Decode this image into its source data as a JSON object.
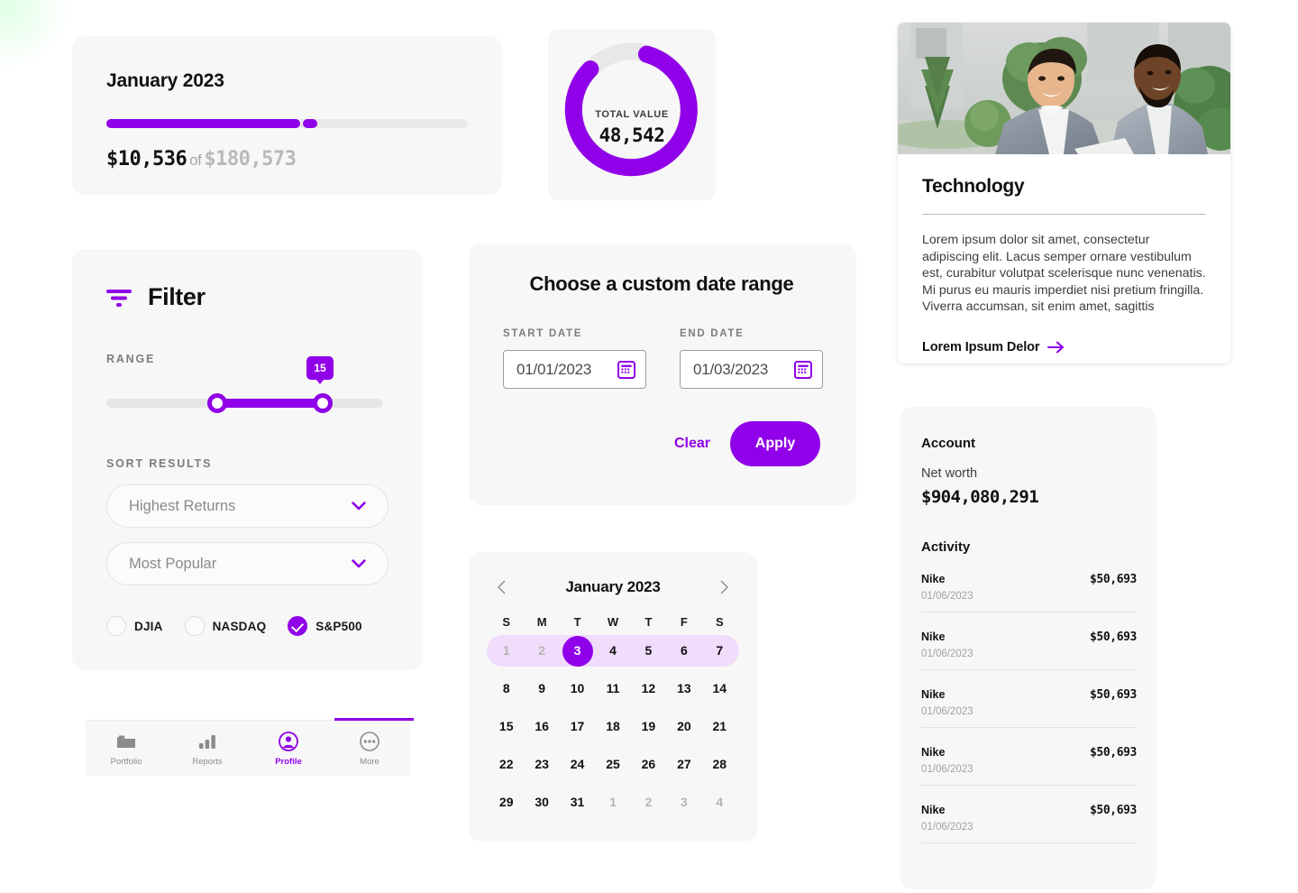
{
  "theme": {
    "accent": "#9000e8",
    "card_bg": "#f7f7f7",
    "page_bg": "#ffffff",
    "highlight": "#f0dcfb"
  },
  "progress_card": {
    "title": "January 2023",
    "current_amount": "$10,536",
    "of_word": "of",
    "total_amount": "$180,573",
    "percent_filled": 54
  },
  "donut_card": {
    "label": "TOTAL VALUE",
    "value": "48,542",
    "percent_filled": 76
  },
  "filter_panel": {
    "icon": "filter-funnel-icon",
    "title": "Filter",
    "range_label": "RANGE",
    "range_value": "15",
    "range_low_pct": 40,
    "range_high_pct": 78,
    "sort_label": "SORT RESULTS",
    "selects": [
      {
        "value": "Highest Returns",
        "icon": "chevron-down-icon"
      },
      {
        "value": "Most Popular",
        "icon": "chevron-down-icon"
      }
    ],
    "radios": [
      {
        "label": "DJIA",
        "checked": false
      },
      {
        "label": "NASDAQ",
        "checked": false
      },
      {
        "label": "S&P500",
        "checked": true
      }
    ]
  },
  "bottom_nav": {
    "items": [
      {
        "label": "Portfolio",
        "icon": "folder-icon",
        "active": false
      },
      {
        "label": "Reports",
        "icon": "bar-chart-icon",
        "active": false
      },
      {
        "label": "Profile",
        "icon": "user-circle-icon",
        "active": true
      },
      {
        "label": "More",
        "icon": "ellipsis-circle-icon",
        "active": false
      }
    ]
  },
  "date_range_card": {
    "title": "Choose a custom date range",
    "start": {
      "label": "START DATE",
      "value": "01/01/2023",
      "icon": "calendar-icon"
    },
    "end": {
      "label": "END DATE",
      "value": "01/03/2023",
      "icon": "calendar-icon"
    },
    "clear_label": "Clear",
    "apply_label": "Apply"
  },
  "calendar_card": {
    "month": "January 2023",
    "prev_icon": "chevron-left-icon",
    "next_icon": "chevron-right-icon",
    "weekdays": [
      "S",
      "M",
      "T",
      "W",
      "T",
      "F",
      "S"
    ],
    "weeks": [
      {
        "highlight": true,
        "days": [
          {
            "n": "1",
            "muted": true
          },
          {
            "n": "2",
            "muted": true
          },
          {
            "n": "3",
            "selected": true
          },
          {
            "n": "4"
          },
          {
            "n": "5"
          },
          {
            "n": "6"
          },
          {
            "n": "7"
          }
        ]
      },
      {
        "highlight": false,
        "days": [
          {
            "n": "8"
          },
          {
            "n": "9"
          },
          {
            "n": "10"
          },
          {
            "n": "11"
          },
          {
            "n": "12"
          },
          {
            "n": "13"
          },
          {
            "n": "14"
          }
        ]
      },
      {
        "highlight": false,
        "days": [
          {
            "n": "15"
          },
          {
            "n": "16"
          },
          {
            "n": "17"
          },
          {
            "n": "18"
          },
          {
            "n": "19"
          },
          {
            "n": "20"
          },
          {
            "n": "21"
          }
        ]
      },
      {
        "highlight": false,
        "days": [
          {
            "n": "22"
          },
          {
            "n": "23"
          },
          {
            "n": "24"
          },
          {
            "n": "25"
          },
          {
            "n": "26"
          },
          {
            "n": "27"
          },
          {
            "n": "28"
          }
        ]
      },
      {
        "highlight": false,
        "days": [
          {
            "n": "29"
          },
          {
            "n": "30"
          },
          {
            "n": "31"
          },
          {
            "n": "1",
            "muted": true
          },
          {
            "n": "2",
            "muted": true
          },
          {
            "n": "3",
            "muted": true
          },
          {
            "n": "4",
            "muted": true
          }
        ]
      }
    ]
  },
  "tech_card": {
    "photo_alt": "two-businessmen-talking-outdoors-photo",
    "title": "Technology",
    "body": "Lorem ipsum dolor sit amet, consectetur adipiscing elit. Lacus semper ornare vestibulum est, curabitur volutpat scelerisque nunc venenatis. Mi purus eu mauris imperdiet nisi pretium fringilla. Viverra accumsan, sit enim amet, sagittis",
    "link_label": "Lorem Ipsum Delor",
    "link_icon": "arrow-right-icon"
  },
  "account_card": {
    "title": "Account",
    "networth_label": "Net worth",
    "networth_value": "$904,080,291",
    "activity_title": "Activity",
    "activity": [
      {
        "name": "Nike",
        "amount": "$50,693",
        "date": "01/06/2023"
      },
      {
        "name": "Nike",
        "amount": "$50,693",
        "date": "01/06/2023"
      },
      {
        "name": "Nike",
        "amount": "$50,693",
        "date": "01/06/2023"
      },
      {
        "name": "Nike",
        "amount": "$50,693",
        "date": "01/06/2023"
      },
      {
        "name": "Nike",
        "amount": "$50,693",
        "date": "01/06/2023"
      }
    ]
  }
}
